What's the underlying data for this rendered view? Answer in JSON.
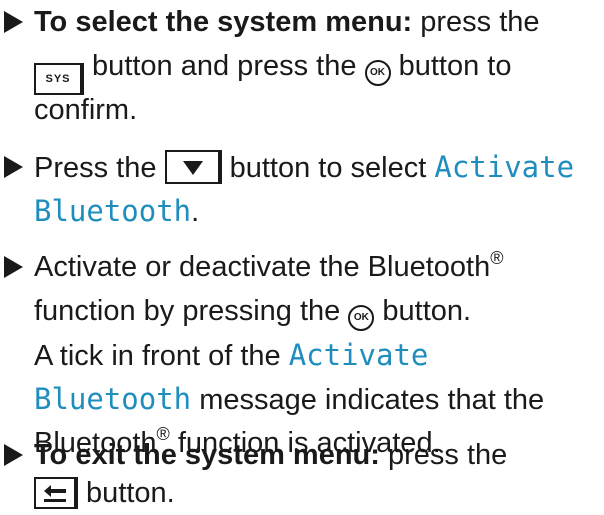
{
  "steps": [
    {
      "lead_bold": "To select the system menu:",
      "text1": " press the",
      "key_sys": "SYS",
      "text2": " button and press the ",
      "ok_key": "OK",
      "text3": " button to",
      "text4": "confirm."
    },
    {
      "text1": "Press the ",
      "text2": " button to select ",
      "menu_item_part1": "Activate",
      "menu_item_part2": "Bluetooth",
      "text3": "."
    },
    {
      "text1": "Activate or deactivate the Bluetooth",
      "reg1": "®",
      "text2": "function by pressing the ",
      "ok_key": "OK",
      "text3": " button.",
      "text4": "A tick in front of the ",
      "menu_item_part1": "Activate",
      "menu_item_part2": "Bluetooth",
      "text5": " message indicates that the",
      "text6": "Bluetooth",
      "reg2": "®",
      "text7": " function is activated."
    },
    {
      "lead_bold": "To exit the system menu:",
      "text1": " press the",
      "text2": " button."
    }
  ],
  "icons": {
    "bullet": "triangle-right-icon",
    "down_key": "down-arrow-key-icon",
    "back_key": "back-key-icon",
    "ok_key": "ok-button-icon"
  },
  "colors": {
    "menu_text": "#1f8dbd",
    "body_text": "#1a1a1a"
  }
}
